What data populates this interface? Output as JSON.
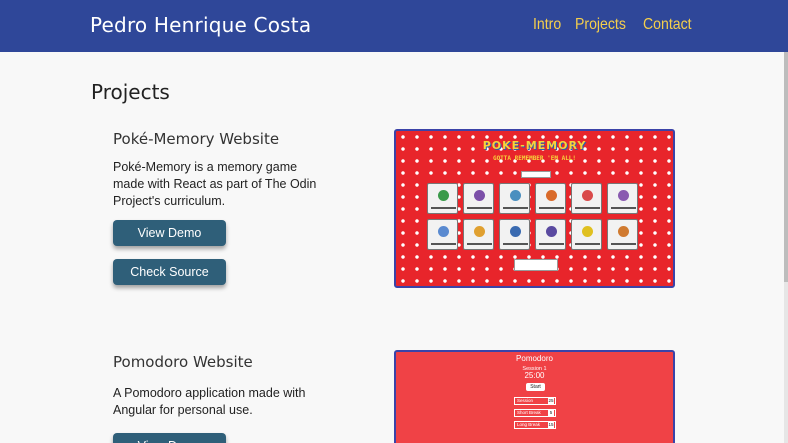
{
  "header": {
    "brand": "Pedro Henrique Costa",
    "nav": [
      "Intro",
      "Projects",
      "Contact"
    ],
    "bg_color": "#2f4799",
    "nav_color": "#f5cf4c"
  },
  "section": {
    "title": "Projects"
  },
  "projects": [
    {
      "title": "Poké-Memory Website",
      "description": "Poké-Memory is a memory game made with React as part of The Odin Project's curriculum.",
      "buttons": {
        "demo": "View Demo",
        "source": "Check Source"
      },
      "preview": {
        "title": "POKE-MEMORY",
        "subtitle": "GOTTA REMEMBER 'EM ALL!",
        "card_colors": [
          "#3a9a4a",
          "#7b4fa8",
          "#4a8fbf",
          "#d96a2a",
          "#d94a4a",
          "#8a5bb0",
          "#5a8ad0",
          "#e0a030",
          "#3a6ab0",
          "#5a4aa0",
          "#e0c020",
          "#d07a30"
        ]
      }
    },
    {
      "title": "Pomodoro Website",
      "description": "A Pomodoro application made with Angular for personal use.",
      "buttons": {
        "demo": "View Demo"
      },
      "preview": {
        "title": "Pomodoro",
        "session": "Session 1",
        "time": "25:00",
        "start": "Start",
        "rows": [
          {
            "label": "Session",
            "value": "25"
          },
          {
            "label": "Short Break",
            "value": "5"
          },
          {
            "label": "Long Break",
            "value": "15"
          }
        ]
      }
    }
  ]
}
